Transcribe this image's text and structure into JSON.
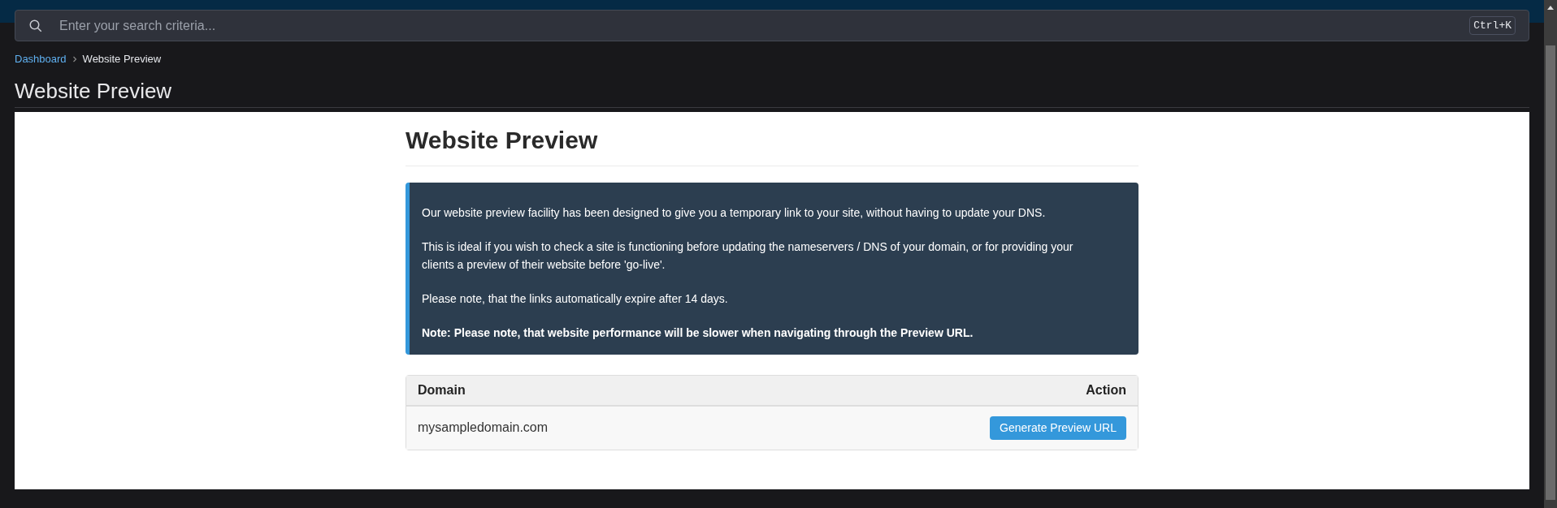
{
  "search": {
    "placeholder": "Enter your search criteria...",
    "shortcut": "Ctrl+K"
  },
  "breadcrumb": [
    {
      "label": "Dashboard",
      "selected": false
    },
    {
      "label": "Website Preview",
      "selected": true
    }
  ],
  "page_title": "Website Preview",
  "panel": {
    "heading": "Website Preview",
    "info": [
      "Our website preview facility has been designed to give you a temporary link to your site, without having to update your DNS.",
      "This is ideal if you wish to check a site is functioning before updating the nameservers / DNS of your domain, or for providing your clients a preview of their website before 'go-live'.",
      "Please note, that the links automatically expire after 14 days."
    ],
    "note": "Note: Please note, that website performance will be slower when navigating through the Preview URL.",
    "table": {
      "columns": [
        "Domain",
        "Action"
      ],
      "rows": [
        {
          "domain": "mysampledomain.com",
          "action": "Generate Preview URL"
        }
      ]
    }
  }
}
